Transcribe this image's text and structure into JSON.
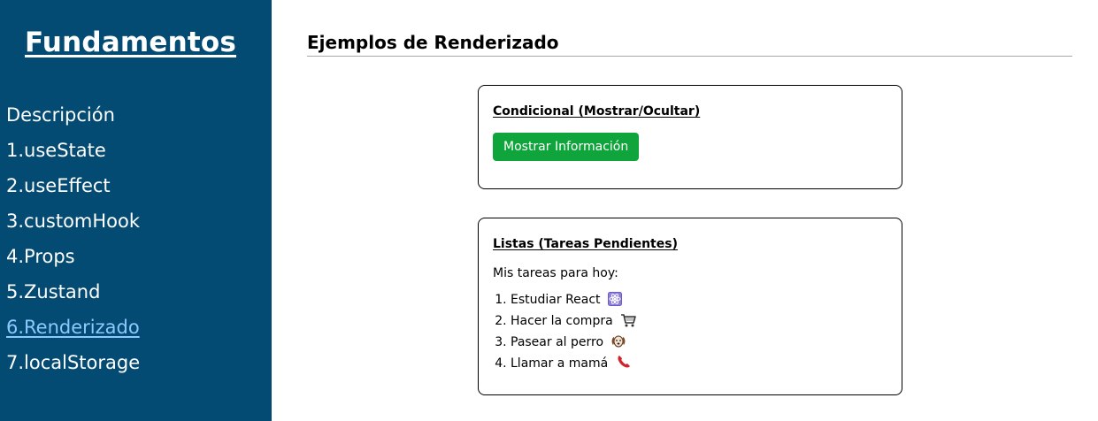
{
  "sidebar": {
    "brand": "Fundamentos",
    "items": [
      {
        "label": "Descripción",
        "active": false
      },
      {
        "label": "1.useState",
        "active": false
      },
      {
        "label": "2.useEffect",
        "active": false
      },
      {
        "label": "3.customHook",
        "active": false
      },
      {
        "label": "4.Props",
        "active": false
      },
      {
        "label": "5.Zustand",
        "active": false
      },
      {
        "label": "6.Renderizado",
        "active": true
      },
      {
        "label": "7.localStorage",
        "active": false
      }
    ]
  },
  "main": {
    "title": "Ejemplos de Renderizado",
    "conditional_card": {
      "title": "Condicional (Mostrar/Ocultar)",
      "button_label": "Mostrar Información"
    },
    "list_card": {
      "title": "Listas (Tareas Pendientes)",
      "intro": "Mis tareas para hoy:",
      "tasks": [
        {
          "text": "Estudiar React",
          "icon": "atom-icon"
        },
        {
          "text": "Hacer la compra",
          "icon": "shopping-cart-icon"
        },
        {
          "text": "Pasear al perro",
          "icon": "dog-icon"
        },
        {
          "text": "Llamar a mamá",
          "icon": "telephone-icon"
        }
      ]
    }
  },
  "colors": {
    "sidebar_bg": "#044b73",
    "active_link": "#8cc9ff",
    "button_bg": "#10a43c"
  }
}
